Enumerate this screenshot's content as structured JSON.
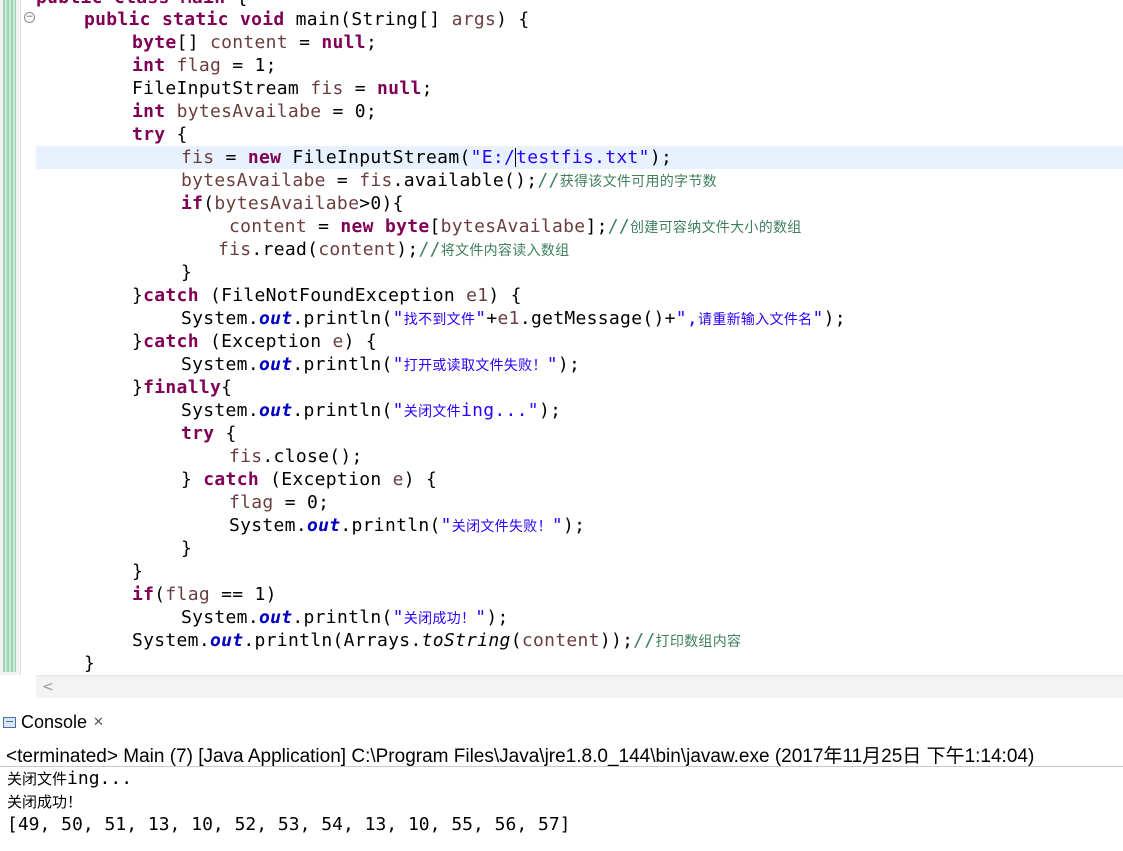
{
  "editor": {
    "code_lines": [
      "public static void main(String[] args) {",
      "byte[] content = null;",
      "int flag = 1;",
      "FileInputStream fis = null;",
      "int bytesAvailabe = 0;",
      "try {",
      "fis = new FileInputStream(\"E:/testfis.txt\");",
      "bytesAvailabe = fis.available();//获得该文件可用的字节数",
      "if(bytesAvailabe>0){",
      "content = new byte[bytesAvailabe];//创建可容纳文件大小的数组",
      "fis.read(content);//将文件内容读入数组",
      "}",
      "}catch (FileNotFoundException e1) {",
      "System.out.println(\"找不到文件\"+e1.getMessage()+\",请重新输入文件名\");",
      "}catch (Exception e) {",
      "System.out.println(\"打开或读取文件失败！\");",
      "}finally{",
      "System.out.println(\"关闭文件ing...\");",
      "try {",
      "fis.close();",
      "} catch (Exception e) {",
      "flag = 0;",
      "System.out.println(\"关闭文件失败！\");",
      "}",
      "}",
      "if(flag == 1)",
      "System.out.println(\"关闭成功！\");",
      "System.out.println(Arrays.toString(content));//打印数组内容",
      "}"
    ]
  },
  "console": {
    "tab_label": "Console",
    "status": "<terminated> Main (7) [Java Application] C:\\Program Files\\Java\\jre1.8.0_144\\bin\\javaw.exe (2017年11月25日 下午1:14:04)",
    "output": [
      "关闭文件ing...",
      "关闭成功！",
      "[49, 50, 51, 13, 10, 52, 53, 54, 13, 10, 55, 56, 57]"
    ]
  },
  "colors": {
    "keyword": "#7f0055",
    "string": "#2a00ff",
    "comment": "#3f7f5f",
    "local_variable": "#6a3e3e",
    "static_field": "#0000c0",
    "current_line": "#e8f2fe"
  }
}
